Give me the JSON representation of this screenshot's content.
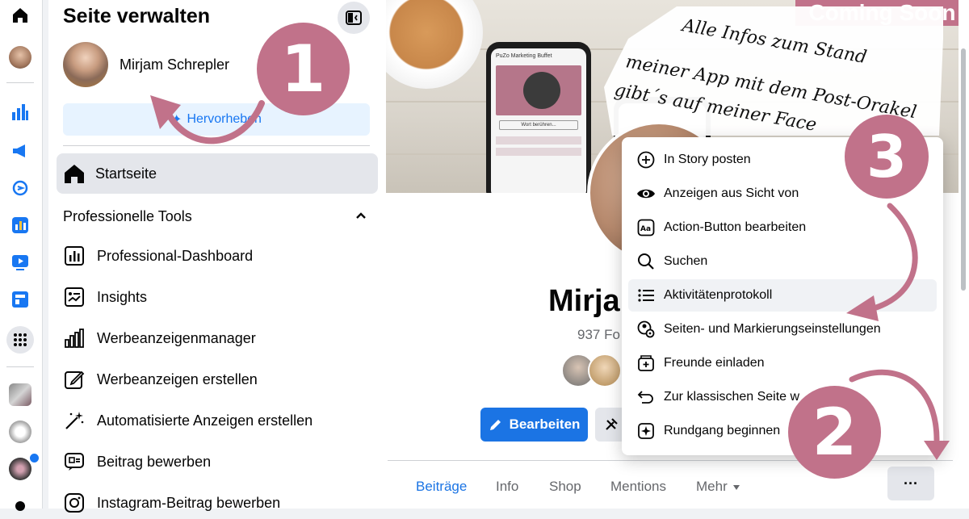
{
  "panel": {
    "title": "Seite verwalten",
    "profile_name": "Mirjam Schrepler",
    "highlight_label": "Hervorheben",
    "home_label": "Startseite",
    "section_title": "Professionelle Tools",
    "tools": [
      {
        "label": "Professional-Dashboard",
        "icon": "dashboard-icon"
      },
      {
        "label": "Insights",
        "icon": "insights-icon"
      },
      {
        "label": "Werbeanzeigenmanager",
        "icon": "ads-manager-icon"
      },
      {
        "label": "Werbeanzeigen erstellen",
        "icon": "create-ad-icon"
      },
      {
        "label": "Automatisierte Anzeigen erstellen",
        "icon": "magic-wand-icon"
      },
      {
        "label": "Beitrag bewerben",
        "icon": "promote-post-icon"
      },
      {
        "label": "Instagram-Beitrag bewerben",
        "icon": "instagram-icon"
      }
    ]
  },
  "cover": {
    "coming_soon": "Coming Soon",
    "note_lines": [
      "Alle Infos zum Stand",
      "meiner App mit dem Post-Orakel",
      "gibt´s auf meiner Face"
    ],
    "phone_title": "PuZo Marketing Buffet",
    "phone_button": "Wort berühren..."
  },
  "page": {
    "name_partial": "Mirja",
    "followers_partial": "937 Fo",
    "edit_label": "Bearbeiten"
  },
  "tabs": [
    {
      "label": "Beiträge",
      "active": true
    },
    {
      "label": "Info",
      "active": false
    },
    {
      "label": "Shop",
      "active": false
    },
    {
      "label": "Mentions",
      "active": false
    },
    {
      "label": "Mehr",
      "active": false
    }
  ],
  "more_button": "···",
  "menu": {
    "items": [
      {
        "label": "In Story posten",
        "icon": "plus-circle-icon"
      },
      {
        "label": "Anzeigen aus Sicht von",
        "icon": "eye-icon"
      },
      {
        "label": "Action-Button bearbeiten",
        "icon": "action-button-icon"
      },
      {
        "label": "Suchen",
        "icon": "search-icon"
      },
      {
        "label": "Aktivitätenprotokoll",
        "icon": "activity-list-icon",
        "active": true
      },
      {
        "label": "Seiten- und Markierungseinstellungen",
        "icon": "tag-settings-icon"
      },
      {
        "label": "Freunde einladen",
        "icon": "invite-friends-icon"
      },
      {
        "label": "Zur klassischen Seite w",
        "icon": "undo-icon"
      },
      {
        "label": "Rundgang beginnen",
        "icon": "tour-icon"
      }
    ]
  },
  "badges": {
    "one": "1",
    "two": "2",
    "three": "3"
  },
  "colors": {
    "accent": "#1b74e4",
    "badge": "#c1728a",
    "highlight_bg": "#e7f3ff"
  }
}
